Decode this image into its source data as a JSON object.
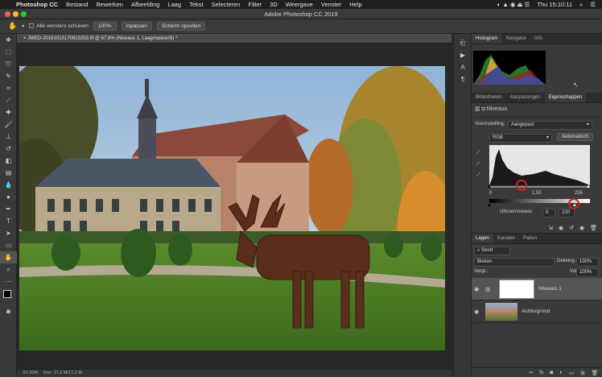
{
  "menubar": {
    "apple": "",
    "app": "Photoshop CC",
    "items": [
      "Bestand",
      "Bewerken",
      "Afbeelding",
      "Laag",
      "Tekst",
      "Selecteren",
      "Filter",
      "3D",
      "Weergave",
      "Venster",
      "Help"
    ],
    "clock": "Thu 15:10:11"
  },
  "window": {
    "title": "Adobe Photoshop CC 2019"
  },
  "options": {
    "scroll_all": "Alle vensters schuiven",
    "zoom": "100%",
    "fit": "Inpassen",
    "fill": "Scherm opvullen"
  },
  "document": {
    "tab": "JWED-20181013170913253.tif @ 67,9% (Niveaus 1, Laagmasker/8) *",
    "zoom": "67,93%",
    "doc": "Doc: 17,2 M/17,2 M"
  },
  "top_panel": {
    "tabs": [
      "Histogram",
      "Navigator",
      "Info"
    ]
  },
  "props": {
    "tabs": [
      "Bibliotheken",
      "Aanpassingen",
      "Eigenschappen"
    ],
    "title": "Niveaus",
    "preset_label": "Voorinstelling:",
    "preset": "Aangepast",
    "channel": "RGB",
    "auto": "Automatisch",
    "in_black": "0",
    "in_mid": "1,50",
    "in_white": "255",
    "out_label": "Uitvoerniveaus:",
    "out_black": "0",
    "out_white": "220"
  },
  "layers": {
    "tabs": [
      "Lagen",
      "Kanalen",
      "Paden"
    ],
    "kind": "Soort",
    "blend": "Bleken",
    "opacity_label": "Dekking:",
    "opacity": "100%",
    "lock_label": "Vergr.:",
    "fill_label": "Vul:",
    "fill": "100%",
    "items": [
      {
        "name": "Niveaus 1"
      },
      {
        "name": "Achtergrond"
      }
    ]
  },
  "colors": {
    "accent_red": "#d32020",
    "panel": "#3a3a3a"
  }
}
